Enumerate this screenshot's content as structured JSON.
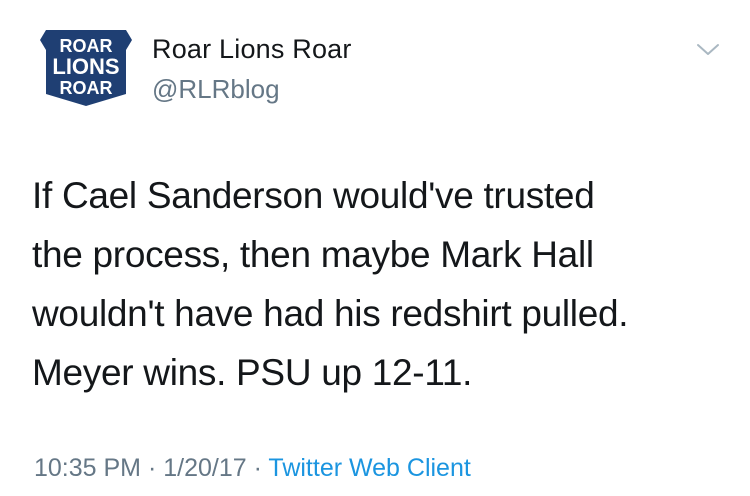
{
  "account": {
    "logo_text": [
      "ROAR",
      "LIONS",
      "ROAR"
    ],
    "display_name": "Roar Lions Roar",
    "handle": "@RLRblog",
    "logo_color": "#1f3f73"
  },
  "tweet": {
    "lines": [
      "If Cael Sanderson would've trusted",
      "the process, then maybe Mark Hall",
      "wouldn't have had his redshirt pulled.",
      "Meyer wins. PSU up 12-11."
    ]
  },
  "meta": {
    "time": "10:35 PM",
    "separator": " · ",
    "date": "1/20/17",
    "client": "Twitter Web Client"
  },
  "icons": {
    "menu": "chevron-down-icon"
  }
}
